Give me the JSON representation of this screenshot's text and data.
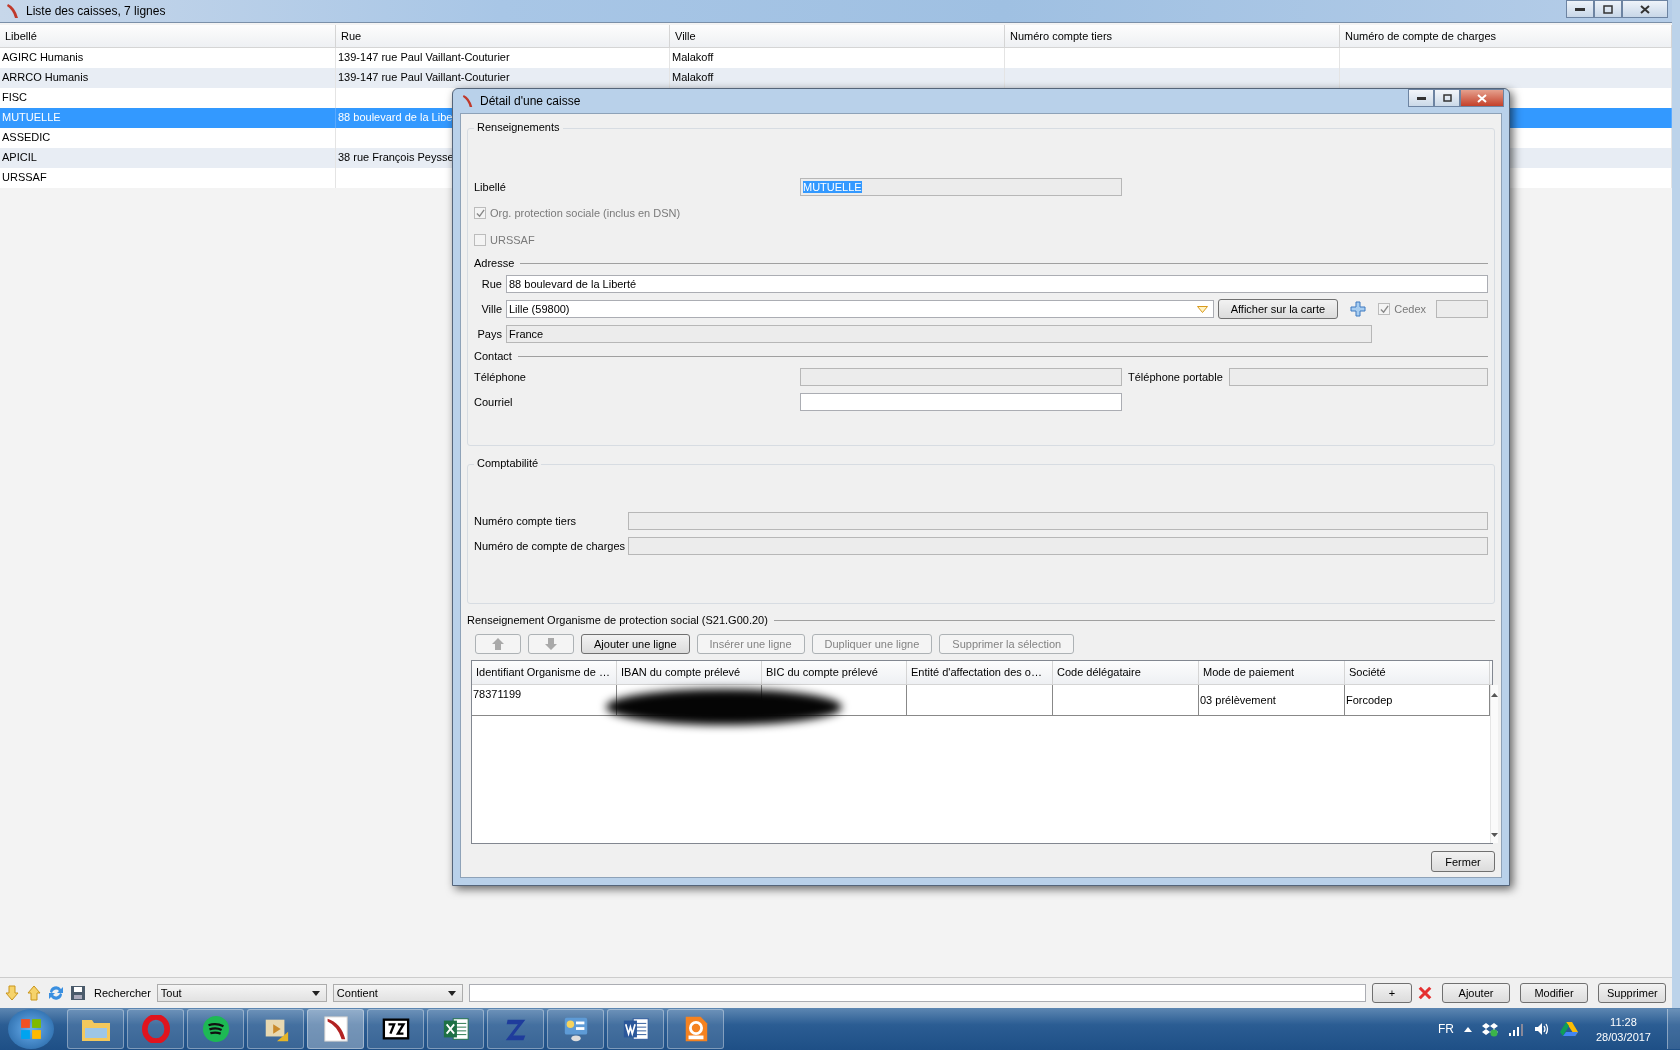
{
  "window": {
    "title": "Liste des caisses, 7 lignes"
  },
  "list": {
    "columns": [
      "Libellé",
      "Rue",
      "Ville",
      "Numéro compte tiers",
      "Numéro de compte de charges"
    ],
    "rows": [
      {
        "libelle": "AGIRC Humanis",
        "rue": "139-147 rue Paul Vaillant-Couturier",
        "ville": "Malakoff",
        "selected": false
      },
      {
        "libelle": "ARRCO Humanis",
        "rue": "139-147 rue Paul Vaillant-Couturier",
        "ville": "Malakoff",
        "selected": false
      },
      {
        "libelle": "FISC",
        "selected": false
      },
      {
        "libelle": "MUTUELLE",
        "rue": "88 boulevard de la Libe",
        "selected": true
      },
      {
        "libelle": "ASSEDIC",
        "selected": false
      },
      {
        "libelle": "APICIL",
        "rue": "38 rue François Peysse",
        "selected": false
      },
      {
        "libelle": "URSSAF",
        "selected": false
      }
    ]
  },
  "dialog": {
    "title": "Détail d'une caisse",
    "renseignements": {
      "legend": "Renseignements",
      "libelle": {
        "label": "Libellé",
        "value": "MUTUELLE",
        "disabled": true
      },
      "checkboxes": [
        {
          "label": "Org. protection sociale (inclus en DSN)",
          "checked": true,
          "disabled": true
        },
        {
          "label": "URSSAF",
          "checked": false,
          "disabled": true
        }
      ],
      "adresse": {
        "heading": "Adresse",
        "rue": {
          "label": "Rue",
          "value": "88 boulevard de la Liberté",
          "disabled": false
        },
        "ville": {
          "label": "Ville",
          "value": "Lille (59800)",
          "disabled": false
        },
        "map_button": "Afficher sur la carte",
        "cedex": {
          "label": "Cedex",
          "checked": true,
          "disabled": true
        },
        "pays": {
          "label": "Pays",
          "value": "France",
          "disabled": true
        }
      },
      "contact": {
        "heading": "Contact",
        "telephone": {
          "label": "Téléphone",
          "disabled": true
        },
        "portable": {
          "label": "Téléphone portable",
          "disabled": true
        },
        "courriel": {
          "label": "Courriel",
          "disabled": false
        }
      }
    },
    "comptabilite": {
      "legend": "Comptabilité",
      "fields": [
        {
          "label": "Numéro compte tiers",
          "disabled": true
        },
        {
          "label": "Numéro de compte de charges",
          "disabled": true
        }
      ]
    },
    "organismes": {
      "heading": "Renseignement Organisme de protection social (S21.G00.20)",
      "buttons": [
        {
          "kind": "up",
          "disabled": true
        },
        {
          "kind": "down",
          "disabled": true
        },
        {
          "kind": "text",
          "label": "Ajouter une ligne",
          "disabled": false
        },
        {
          "kind": "text",
          "label": "Insérer une ligne",
          "disabled": true
        },
        {
          "kind": "text",
          "label": "Dupliquer une ligne",
          "disabled": true
        },
        {
          "kind": "text",
          "label": "Supprimer la sélection",
          "disabled": true
        }
      ],
      "columns": [
        "Identifiant Organisme de …",
        "IBAN du compte prélevé",
        "BIC du compte prélevé",
        "Entité d'affectation des o…",
        "Code délégataire",
        "Mode de paiement",
        "Société"
      ],
      "rows": [
        {
          "identifiant": "78371199",
          "mode": "03 prélèvement",
          "societe": "Forcodep"
        }
      ]
    },
    "close_button": "Fermer"
  },
  "toolbar": {
    "search_label": "Rechercher",
    "scope": "Tout",
    "operator": "Contient",
    "add_button": "+",
    "buttons": [
      "Ajouter",
      "Modifier",
      "Supprimer"
    ]
  },
  "taskbar": {
    "language": "FR",
    "time": "11:28",
    "date": "28/03/2017"
  }
}
